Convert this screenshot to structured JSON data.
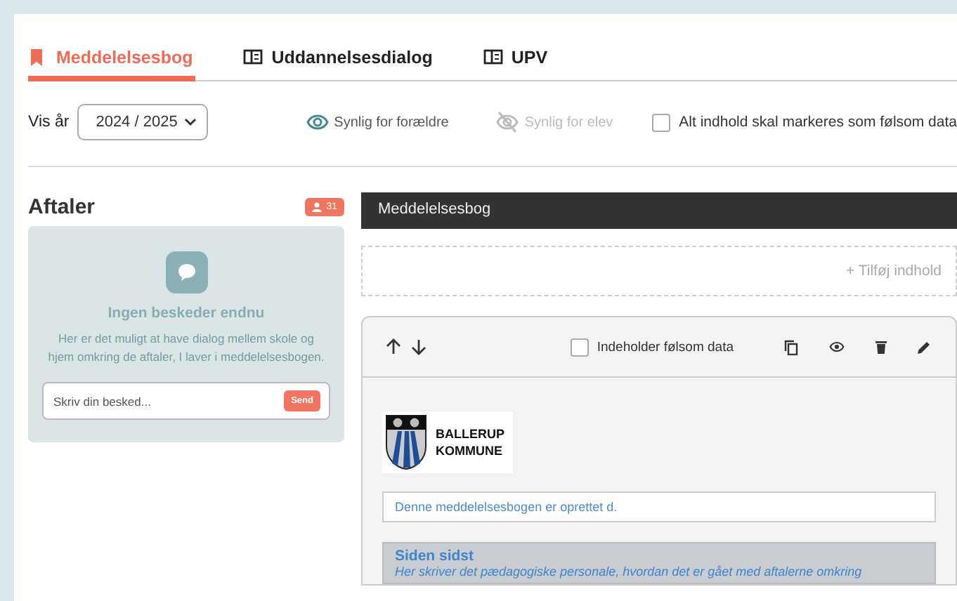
{
  "tabs": [
    {
      "label": "Meddelelsesbog",
      "selected": true
    },
    {
      "label": "Uddannelsesdialog",
      "selected": false
    },
    {
      "label": "UPV",
      "selected": false
    }
  ],
  "filters": {
    "year_label": "Vis år",
    "year": "2024 / 2025",
    "visibility": [
      {
        "label": "Synlig for forældre",
        "on": true
      },
      {
        "label": "Synlig for elev",
        "on": false
      }
    ],
    "sensitive_all": {
      "label": "Alt indhold skal markeres som følsom data",
      "checked": false
    }
  },
  "aftaler": {
    "title": "Aftaler",
    "count": "31",
    "empty_title": "Ingen beskeder endnu",
    "empty_text": "Her er det muligt at have dialog mellem skole og hjem omkring de aftaler, I laver i meddelelsesbogen.",
    "input": {
      "placeholder": "Skriv din besked..."
    },
    "send": "Send"
  },
  "notebook": {
    "header": "Meddelelsesbog",
    "add": "+ Tilføj indhold",
    "card": {
      "sensitive": {
        "label": "Indeholder følsom data",
        "checked": false
      },
      "logo": [
        "BALLERUP",
        "KOMMUNE"
      ],
      "created": "Denne meddelelsesbogen er oprettet d.",
      "section_title": "Siden sidst",
      "section_text": "Her skriver det pædagogiske personale, hvordan det er gået med aftalerne omkring"
    }
  }
}
